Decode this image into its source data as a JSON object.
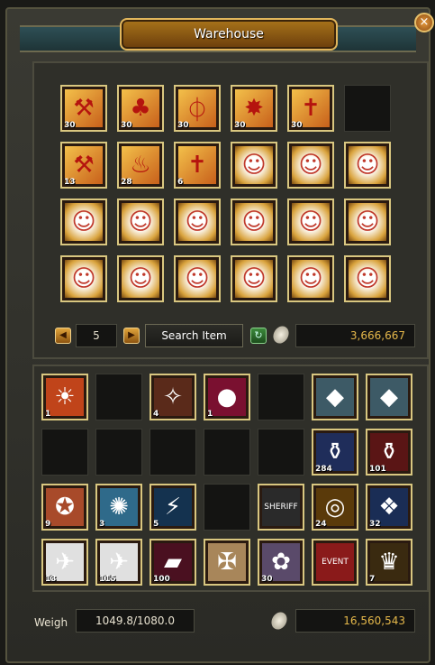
{
  "window": {
    "title": "Warehouse",
    "close_glyph": "×"
  },
  "warehouse": {
    "page": "5",
    "search_label": "Search Item",
    "gold": "3,666,667",
    "slots": [
      {
        "icon": "red-scroll-icon",
        "glyph": "⚒",
        "qty": "30",
        "kind": "scroll"
      },
      {
        "icon": "red-scroll-icon",
        "glyph": "♣",
        "qty": "30",
        "kind": "scroll"
      },
      {
        "icon": "red-scroll-icon",
        "glyph": "⏀",
        "qty": "30",
        "kind": "scroll"
      },
      {
        "icon": "red-scroll-icon",
        "glyph": "✸",
        "qty": "30",
        "kind": "scroll"
      },
      {
        "icon": "red-scroll-icon",
        "glyph": "✝",
        "qty": "30",
        "kind": "scroll"
      },
      {
        "icon": "",
        "glyph": "",
        "qty": "",
        "kind": "empty"
      },
      {
        "icon": "red-scroll-icon",
        "glyph": "⚒",
        "qty": "13",
        "kind": "scroll"
      },
      {
        "icon": "red-scroll-icon",
        "glyph": "♨",
        "qty": "28",
        "kind": "scroll"
      },
      {
        "icon": "red-scroll-icon",
        "glyph": "✝",
        "qty": "6",
        "kind": "scroll"
      },
      {
        "icon": "npc-portrait-icon",
        "glyph": "☺",
        "qty": "",
        "kind": "npc"
      },
      {
        "icon": "npc-portrait-icon",
        "glyph": "☺",
        "qty": "",
        "kind": "npc"
      },
      {
        "icon": "npc-portrait-icon",
        "glyph": "☺",
        "qty": "",
        "kind": "npc"
      },
      {
        "icon": "npc-portrait-icon",
        "glyph": "☺",
        "qty": "",
        "kind": "npc"
      },
      {
        "icon": "npc-portrait-icon",
        "glyph": "☺",
        "qty": "",
        "kind": "npc"
      },
      {
        "icon": "npc-portrait-icon",
        "glyph": "☺",
        "qty": "",
        "kind": "npc"
      },
      {
        "icon": "npc-portrait-icon",
        "glyph": "☺",
        "qty": "",
        "kind": "npc"
      },
      {
        "icon": "npc-portrait-icon",
        "glyph": "☺",
        "qty": "",
        "kind": "npc"
      },
      {
        "icon": "npc-portrait-icon",
        "glyph": "☺",
        "qty": "",
        "kind": "npc"
      },
      {
        "icon": "npc-portrait-icon",
        "glyph": "☺",
        "qty": "",
        "kind": "npc"
      },
      {
        "icon": "npc-portrait-icon",
        "glyph": "☺",
        "qty": "",
        "kind": "npc"
      },
      {
        "icon": "npc-portrait-icon",
        "glyph": "☺",
        "qty": "",
        "kind": "npc"
      },
      {
        "icon": "npc-portrait-icon",
        "glyph": "☺",
        "qty": "",
        "kind": "npc"
      },
      {
        "icon": "npc-portrait-icon",
        "glyph": "☺",
        "qty": "",
        "kind": "npc"
      },
      {
        "icon": "npc-portrait-icon",
        "glyph": "☺",
        "qty": "",
        "kind": "npc"
      }
    ]
  },
  "inventory": {
    "weigh_label": "Weigh",
    "weight": "1049.8/1080.0",
    "gold": "16,560,543",
    "slots": [
      {
        "icon": "fire-scroll-icon",
        "glyph": "☀",
        "qty": "1",
        "bg": "#c0441a"
      },
      {
        "icon": "",
        "glyph": "",
        "qty": "",
        "bg": ""
      },
      {
        "icon": "flame-scroll-icon",
        "glyph": "✧",
        "qty": "4",
        "bg": "#5a2a1a"
      },
      {
        "icon": "red-orb-icon",
        "glyph": "●",
        "qty": "1",
        "bg": "#7a1030"
      },
      {
        "icon": "",
        "glyph": "",
        "qty": "",
        "bg": ""
      },
      {
        "icon": "blue-gem-icon",
        "glyph": "◆",
        "qty": "",
        "bg": "#3d5a66"
      },
      {
        "icon": "blue-gem-icon",
        "glyph": "◆",
        "qty": "",
        "bg": "#3d5a66"
      },
      {
        "icon": "",
        "glyph": "",
        "qty": "",
        "bg": ""
      },
      {
        "icon": "",
        "glyph": "",
        "qty": "",
        "bg": ""
      },
      {
        "icon": "",
        "glyph": "",
        "qty": "",
        "bg": ""
      },
      {
        "icon": "",
        "glyph": "",
        "qty": "",
        "bg": ""
      },
      {
        "icon": "",
        "glyph": "",
        "qty": "",
        "bg": ""
      },
      {
        "icon": "blue-potion-icon",
        "glyph": "⚱",
        "qty": "284",
        "bg": "#1f2d5a"
      },
      {
        "icon": "red-potion-icon",
        "glyph": "⚱",
        "qty": "101",
        "bg": "#5a1515"
      },
      {
        "icon": "pentagram-scroll-icon",
        "glyph": "✪",
        "qty": "9",
        "bg": "#a84a2a"
      },
      {
        "icon": "swirl-scroll-icon",
        "glyph": "✺",
        "qty": "3",
        "bg": "#2f6a8a"
      },
      {
        "icon": "blue-wand-icon",
        "glyph": "⚡",
        "qty": "5",
        "bg": "#14324f"
      },
      {
        "icon": "",
        "glyph": "",
        "qty": "",
        "bg": ""
      },
      {
        "icon": "sheriff-badge-icon",
        "glyph": "SHERIFF",
        "qty": "",
        "bg": "#2a2a2a"
      },
      {
        "icon": "gold-ring-icon",
        "glyph": "◎",
        "qty": "24",
        "bg": "#5a3a0a"
      },
      {
        "icon": "crystal-icon",
        "glyph": "❖",
        "qty": "32",
        "bg": "#1a2d55"
      },
      {
        "icon": "blue-scroll-icon",
        "glyph": "✈",
        "qty": "13",
        "bg": "#e0e0e0"
      },
      {
        "icon": "red-scroll-icon",
        "glyph": "✈",
        "qty": "115",
        "bg": "#e0e0e0"
      },
      {
        "icon": "red-tube-icon",
        "glyph": "▰",
        "qty": "100",
        "bg": "#4a1020"
      },
      {
        "icon": "purple-map-icon",
        "glyph": "✠",
        "qty": "",
        "bg": "#a8865a"
      },
      {
        "icon": "silver-orb-icon",
        "glyph": "✿",
        "qty": "30",
        "bg": "#5a4a6a"
      },
      {
        "icon": "event-box-icon",
        "glyph": "EVENT",
        "qty": "",
        "bg": "#8a1a1a"
      },
      {
        "icon": "royal-crest-icon",
        "glyph": "♛",
        "qty": "7",
        "bg": "#3a2a10"
      }
    ]
  }
}
